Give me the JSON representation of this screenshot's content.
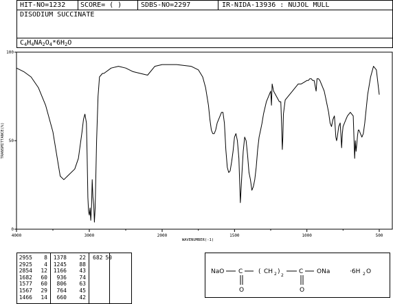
{
  "header": {
    "hit_no": "HIT-NO=1232",
    "score": "SCORE=  (  )",
    "sdbs_no": "SDBS-NO=2297",
    "method": "IR-NIDA-13936 : NUJOL MULL",
    "compound_name": "DISODIUM SUCCINATE",
    "formula_parts": [
      {
        "t": "C",
        "sub": false
      },
      {
        "t": "4",
        "sub": true
      },
      {
        "t": "H",
        "sub": false
      },
      {
        "t": "4",
        "sub": true
      },
      {
        "t": "NA",
        "sub": false
      },
      {
        "t": "2",
        "sub": true
      },
      {
        "t": "O",
        "sub": false
      },
      {
        "t": "4",
        "sub": true
      },
      {
        "t": "*6H",
        "sub": false
      },
      {
        "t": "2",
        "sub": true
      },
      {
        "t": "O",
        "sub": false
      }
    ]
  },
  "chart_data": {
    "type": "line",
    "xlabel": "WAVENUMBER(-1)",
    "ylabel": "TRANSMITTANCE(%)",
    "x_reversed": true,
    "xlim": [
      4000,
      500
    ],
    "ylim": [
      0,
      100
    ],
    "x_ticks": [
      4000,
      3000,
      2000,
      1500,
      1000,
      500
    ],
    "x_tick_labels": [
      "4000",
      "3000",
      "2000",
      "1500",
      "1000",
      "500"
    ],
    "y_ticks": [
      0,
      50,
      100
    ],
    "y_tick_labels": [
      "0",
      "50",
      "100"
    ],
    "series": [
      {
        "x": [
          4000,
          3900,
          3800,
          3700,
          3600,
          3500,
          3400,
          3350,
          3300,
          3200,
          3150,
          3100,
          3080,
          3060,
          3040,
          3030,
          3020,
          3010,
          3000,
          2990,
          2980,
          2970,
          2960,
          2950,
          2940,
          2930,
          2920,
          2910,
          2900,
          2880,
          2860,
          2840,
          2820,
          2800,
          2700,
          2600,
          2500,
          2400,
          2300,
          2200,
          2100,
          2000,
          1900,
          1800,
          1750,
          1720,
          1700,
          1680,
          1670,
          1660,
          1650,
          1640,
          1630,
          1620,
          1600,
          1590,
          1580,
          1570,
          1560,
          1550,
          1540,
          1530,
          1520,
          1510,
          1500,
          1490,
          1480,
          1470,
          1460,
          1450,
          1440,
          1430,
          1420,
          1410,
          1400,
          1390,
          1380,
          1370,
          1360,
          1350,
          1340,
          1330,
          1320,
          1310,
          1300,
          1280,
          1260,
          1250,
          1245,
          1240,
          1230,
          1210,
          1190,
          1180,
          1175,
          1170,
          1166,
          1162,
          1150,
          1120,
          1100,
          1080,
          1060,
          1040,
          1020,
          1000,
          990,
          980,
          970,
          960,
          950,
          936,
          930,
          920,
          910,
          900,
          890,
          880,
          870,
          860,
          850,
          840,
          830,
          820,
          810,
          806,
          800,
          795,
          790,
          780,
          770,
          764,
          760,
          755,
          750,
          740,
          730,
          720,
          700,
          680,
          670,
          665,
          660,
          655,
          650,
          645,
          640,
          630,
          620,
          610,
          600,
          580,
          560,
          540,
          520,
          500
        ],
        "y": [
          91,
          89,
          86,
          80,
          70,
          55,
          30,
          28,
          30,
          34,
          40,
          55,
          62,
          65,
          60,
          42,
          18,
          10,
          8,
          12,
          5,
          12,
          28,
          18,
          14,
          4,
          12,
          30,
          50,
          75,
          86,
          87,
          88,
          88,
          91,
          92,
          91,
          89,
          88,
          87,
          92,
          93,
          93,
          92,
          90,
          86,
          80,
          70,
          62,
          56,
          54,
          54,
          56,
          60,
          64,
          66,
          66,
          60,
          45,
          35,
          32,
          33,
          38,
          44,
          52,
          54,
          50,
          40,
          15,
          30,
          44,
          52,
          50,
          42,
          32,
          28,
          22,
          24,
          28,
          35,
          45,
          52,
          56,
          60,
          65,
          72,
          76,
          78,
          70,
          82,
          78,
          75,
          72,
          72,
          60,
          45,
          52,
          65,
          73,
          76,
          78,
          80,
          82,
          82,
          83,
          84,
          84,
          85,
          85,
          84,
          84,
          78,
          85,
          85,
          84,
          82,
          80,
          78,
          74,
          70,
          66,
          60,
          58,
          62,
          64,
          60,
          52,
          50,
          52,
          58,
          60,
          52,
          46,
          54,
          58,
          60,
          62,
          64,
          66,
          64,
          40,
          50,
          44,
          48,
          53,
          56,
          56,
          54,
          52,
          54,
          60,
          76,
          86,
          92,
          90,
          76
        ]
      }
    ]
  },
  "peak_table": {
    "col1": [
      {
        "wn": "2955",
        "t": "8"
      },
      {
        "wn": "2925",
        "t": "4"
      },
      {
        "wn": "2854",
        "t": "12"
      },
      {
        "wn": "1682",
        "t": "60"
      },
      {
        "wn": "1577",
        "t": "60"
      },
      {
        "wn": "1567",
        "t": "29"
      },
      {
        "wn": "1466",
        "t": "14"
      }
    ],
    "col2": [
      {
        "wn": "1378",
        "t": "22"
      },
      {
        "wn": "1245",
        "t": "88"
      },
      {
        "wn": "1166",
        "t": "43"
      },
      {
        "wn": "936",
        "t": "74"
      },
      {
        "wn": "806",
        "t": "63"
      },
      {
        "wn": "764",
        "t": "45"
      },
      {
        "wn": "660",
        "t": "42"
      }
    ],
    "col3": [
      {
        "wn": "682",
        "t": "50"
      }
    ]
  },
  "structure": {
    "left": "NaO",
    "c1": "C",
    "mid_open": "(",
    "ch": "CH",
    "sub2": "2",
    "mid_close": ")",
    "subscript_n": "2",
    "c2": "C",
    "right": "ONa",
    "o_top1": "O",
    "o_top2": "O",
    "water": "·6H",
    "water_sub": "2",
    "water_o": "O"
  }
}
